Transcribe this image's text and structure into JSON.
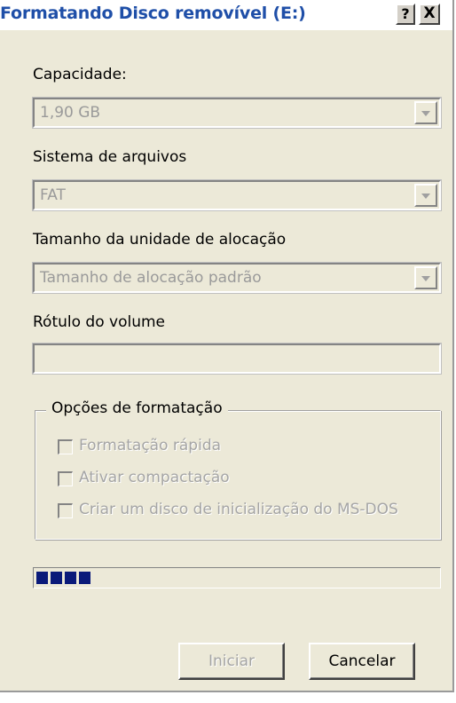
{
  "window": {
    "title": "Formatando Disco removível (E:)",
    "help_label": "?",
    "close_label": "X"
  },
  "capacity": {
    "label": "Capacidade:",
    "value": "1,90 GB"
  },
  "file_system": {
    "label": "Sistema de arquivos",
    "value": "FAT"
  },
  "allocation_unit": {
    "label": "Tamanho da unidade de alocação",
    "value": "Tamanho de alocação padrão"
  },
  "volume_label": {
    "label": "Rótulo do volume",
    "value": ""
  },
  "format_options": {
    "title": "Opções de formatação",
    "options": [
      {
        "label": "Formatação rápida",
        "checked": false,
        "enabled": false
      },
      {
        "label": "Ativar compactação",
        "checked": false,
        "enabled": false
      },
      {
        "label": "Criar um disco de inicialização do MS-DOS",
        "checked": false,
        "enabled": false
      }
    ]
  },
  "progress": {
    "blocks": 4
  },
  "buttons": {
    "start_label": "Iniciar",
    "cancel_label": "Cancelar"
  },
  "colors": {
    "title_text": "#1f4fa8",
    "dialog_background": "#ece9d8",
    "progress_block": "#0a1a7a",
    "disabled_text": "#a5a5a5"
  }
}
